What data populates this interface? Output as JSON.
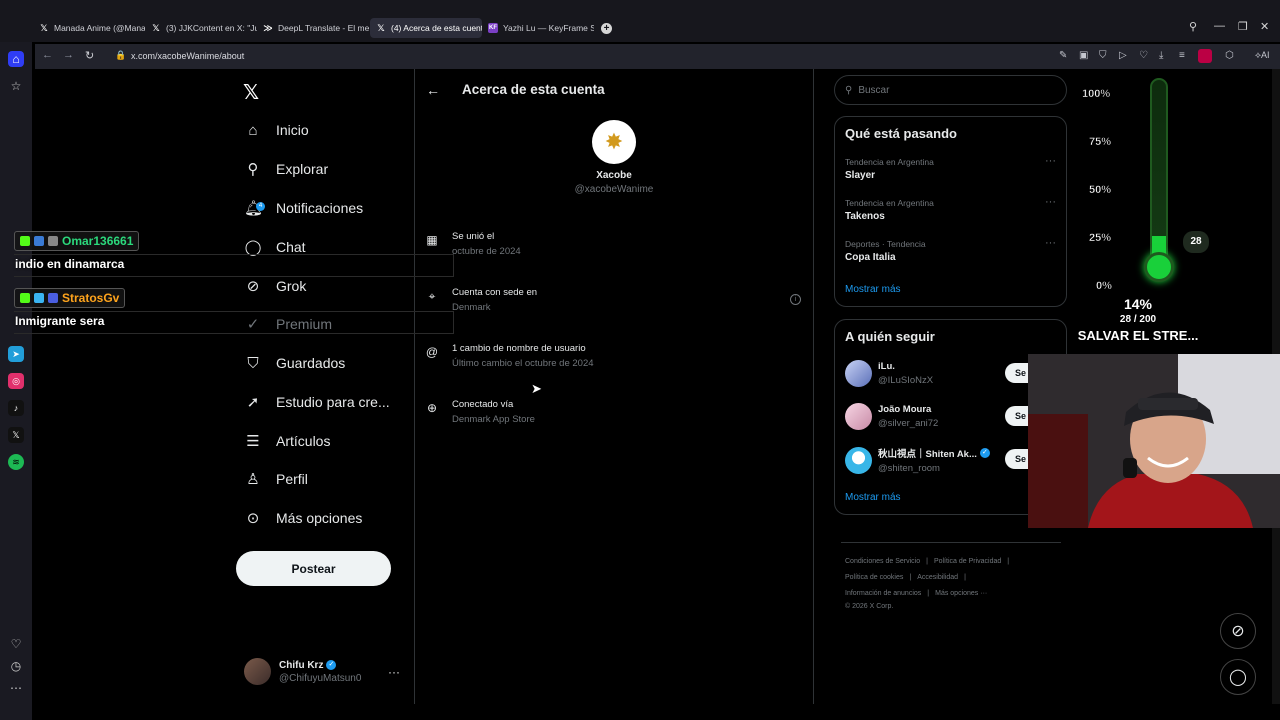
{
  "browser": {
    "tabs": [
      {
        "title": "Manada Anime (@Manad",
        "icon": "x-icon"
      },
      {
        "title": "(3) JJKContent en X: \"Juju",
        "icon": "x-icon"
      },
      {
        "title": "DeepL Translate - El mejo",
        "icon": "deepl-icon"
      },
      {
        "title": "(4) Acerca de esta cuenta",
        "icon": "x-icon",
        "active": true
      },
      {
        "title": "Yazhi Lu — KeyFrame Staf",
        "icon": "keyframe-icon"
      }
    ],
    "kf_icon_text": "KF",
    "url": "x.com/xacobeWanime/about",
    "ai_label": "AI"
  },
  "nav": {
    "items": [
      {
        "label": "Inicio",
        "icon": "home-icon"
      },
      {
        "label": "Explorar",
        "icon": "search-icon"
      },
      {
        "label": "Notificaciones",
        "icon": "bell-icon",
        "badge": "4"
      },
      {
        "label": "Chat",
        "icon": "chat-icon"
      },
      {
        "label": "Grok",
        "icon": "grok-icon"
      },
      {
        "label": "Premium",
        "icon": "premium-icon",
        "dim": true
      },
      {
        "label": "Guardados",
        "icon": "bookmark-icon"
      },
      {
        "label": "Estudio para cre...",
        "icon": "rocket-icon"
      },
      {
        "label": "Artículos",
        "icon": "article-icon"
      },
      {
        "label": "Perfil",
        "icon": "profile-icon"
      },
      {
        "label": "Más opciones",
        "icon": "more-icon"
      }
    ],
    "post_label": "Postear",
    "me": {
      "name": "Chifu Krz",
      "handle": "@ChifuyuMatsun0"
    }
  },
  "main": {
    "title": "Acerca de esta cuenta",
    "profile": {
      "name": "Xacobe",
      "handle": "@xacobeWanime"
    },
    "info": [
      {
        "label": "Se unió el",
        "value": "octubre de 2024",
        "icon": "calendar-icon"
      },
      {
        "label": "Cuenta con sede en",
        "value": "Denmark",
        "icon": "location-icon"
      },
      {
        "label": "1 cambio de nombre de usuario",
        "value": "Último cambio el octubre de 2024",
        "icon": "at-icon"
      },
      {
        "label": "Conectado vía",
        "value": "Denmark App Store",
        "icon": "globe-icon"
      }
    ]
  },
  "right": {
    "search_placeholder": "Buscar",
    "trends_title": "Qué está pasando",
    "trends": [
      {
        "context": "Tendencia en Argentina",
        "name": "Slayer"
      },
      {
        "context": "Tendencia en Argentina",
        "name": "Takenos"
      },
      {
        "context": "Deportes · Tendencia",
        "name": "Copa Italia"
      }
    ],
    "show_more": "Mostrar más",
    "follow_title": "A quién seguir",
    "follow": [
      {
        "name": "iLu.",
        "handle": "@ILuSIoNzX",
        "verified": false
      },
      {
        "name": "João Moura",
        "handle": "@silver_ani72",
        "verified": false
      },
      {
        "name": "秋山視点｜Shiten Ak...",
        "handle": "@shiten_room",
        "verified": true
      }
    ],
    "follow_btn": "Se",
    "footer": {
      "row1": [
        "Condiciones de Servicio",
        "Política de Privacidad"
      ],
      "row2": [
        "Política de cookies",
        "Accesibilidad"
      ],
      "row3": [
        "Información de anuncios",
        "Más opciones ···"
      ],
      "copyright": "© 2026 X Corp."
    }
  },
  "overlay": {
    "thermo_labels": [
      "100%",
      "75%",
      "50%",
      "25%",
      "0%"
    ],
    "thermo_count": "28",
    "thermo_percent": "14%",
    "thermo_fraction": "28 / 200",
    "thermo_level": 0.14,
    "thermo_goal": "SALVAR EL STRE...",
    "chat": [
      {
        "user": "Omar136661",
        "color": "#2bd97c",
        "text": "indio en dinamarca"
      },
      {
        "user": "StratosGv",
        "color": "#ffa41c",
        "text": "Inmigrante sera"
      }
    ]
  },
  "colors": {
    "accent": "#1d9bf0",
    "thermo": "#19d03a",
    "bg": "#000000"
  }
}
